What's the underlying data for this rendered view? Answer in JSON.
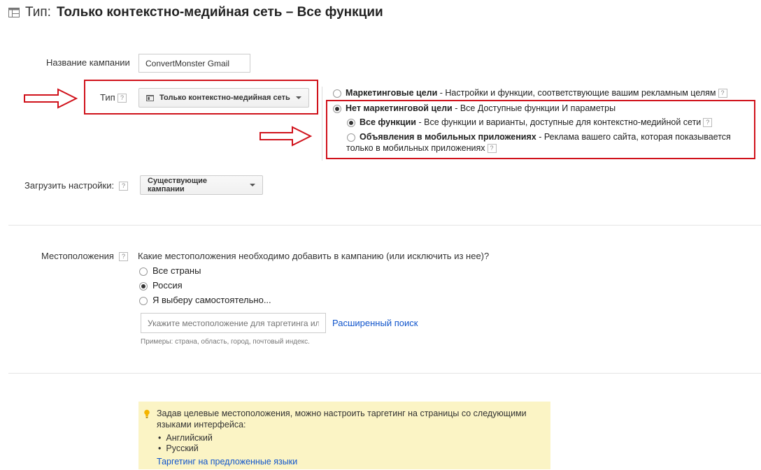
{
  "header": {
    "prefix": "Тип:",
    "title": "Только контекстно-медийная сеть – Все функции"
  },
  "campaign_name": {
    "label": "Название кампании",
    "value": "ConvertMonster Gmail"
  },
  "type": {
    "label": "Тип",
    "button": "Только контекстно-медийная сеть"
  },
  "goals": {
    "marketing": {
      "bold": "Маркетинговые цели",
      "rest": " - Настройки и функции, соответствующие вашим рекламным целям"
    },
    "no_marketing": {
      "bold": "Нет маркетинговой цели",
      "rest": " - Все Доступные функции И параметры"
    },
    "all_functions": {
      "bold": "Все функции",
      "rest": " - Все функции и варианты, доступные для контекстно-медийной сети"
    },
    "mobile_apps": {
      "bold": "Объявления в мобильных приложениях",
      "rest": " - Реклама вашего сайта, которая показывается",
      "rest2": "только в мобильных приложениях"
    }
  },
  "load_settings": {
    "label": "Загрузить настройки:",
    "button": "Существующие кампании"
  },
  "locations": {
    "label": "Местоположения",
    "question": "Какие местоположения необходимо добавить в кампанию (или исключить из нее)?",
    "options": [
      "Все страны",
      "Россия",
      "Я выберу самостоятельно..."
    ],
    "selected": "Россия",
    "search_placeholder": "Укажите местоположение для таргетинга или исключения",
    "advanced_search": "Расширенный поиск",
    "examples": "Примеры: страна, область, город, почтовый индекс."
  },
  "tip": {
    "text_line1": "Задав целевые местоположения, можно настроить таргетинг на страницы со следующими",
    "text_line2": "языками интерфейса:",
    "languages": [
      "Английский",
      "Русский"
    ],
    "link": "Таргетинг на предложенные языки"
  },
  "help_icon": "?",
  "colors": {
    "annotation_red": "#d0121b",
    "link_blue": "#1155cc",
    "tip_bg": "#fbf4c5",
    "bulb_yellow": "#f4b400"
  }
}
